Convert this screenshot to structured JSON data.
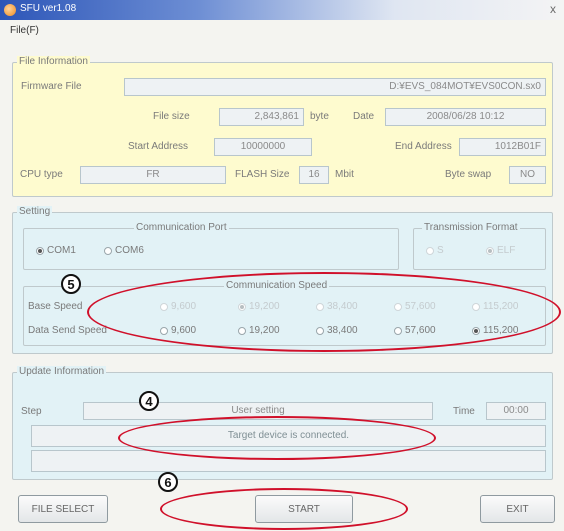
{
  "window": {
    "title": "SFU ver1.08",
    "close_glyph": "x"
  },
  "menu": {
    "items": [
      "File(F)"
    ]
  },
  "file_information": {
    "title": "File Information",
    "firmware_file_label": "Firmware File",
    "firmware_file_value": "D:¥EVS_084MOT¥EVS0CON.sx0",
    "file_size_label": "File size",
    "file_size_value": "2,843,861",
    "file_size_unit": "byte",
    "date_label": "Date",
    "date_value": "2008/06/28 10:12",
    "start_address_label": "Start Address",
    "start_address_value": "10000000",
    "end_address_label": "End Address",
    "end_address_value": "1012B01F",
    "cpu_type_label": "CPU type",
    "cpu_type_value": "FR",
    "flash_size_label": "FLASH Size",
    "flash_size_value": "16",
    "flash_size_unit": "Mbit",
    "byte_swap_label": "Byte swap",
    "byte_swap_value": "NO"
  },
  "setting": {
    "title": "Setting",
    "communication_port": {
      "title": "Communication Port",
      "options": [
        {
          "label": "COM1",
          "selected": true
        },
        {
          "label": "COM6",
          "selected": false
        }
      ]
    },
    "transmission_format": {
      "title": "Transmission Format",
      "options": [
        {
          "label": "S",
          "selected": false
        },
        {
          "label": "ELF",
          "selected": true
        }
      ]
    },
    "communication_speed": {
      "title": "Communication Speed",
      "base_speed_label": "Base Speed",
      "base_speed_options": [
        {
          "label": "9,600",
          "selected": false
        },
        {
          "label": "19,200",
          "selected": true
        },
        {
          "label": "38,400",
          "selected": false
        },
        {
          "label": "57,600",
          "selected": false
        },
        {
          "label": "115,200",
          "selected": false
        }
      ],
      "data_send_speed_label": "Data Send Speed",
      "data_send_speed_options": [
        {
          "label": "9,600",
          "selected": false
        },
        {
          "label": "19,200",
          "selected": false
        },
        {
          "label": "38,400",
          "selected": false
        },
        {
          "label": "57,600",
          "selected": false
        },
        {
          "label": "115,200",
          "selected": true
        }
      ]
    }
  },
  "update_information": {
    "title": "Update Information",
    "step_label": "Step",
    "step_value": "User setting",
    "time_label": "Time",
    "time_value": "00:00",
    "message": "Target device is connected."
  },
  "buttons": {
    "file_select": "FILE SELECT",
    "start": "START",
    "exit": "EXIT"
  },
  "callouts": {
    "speed": "5",
    "status": "4",
    "start": "6"
  },
  "colors": {
    "callout_ellipse": "#d0102a",
    "file_info_bg": "#fefbcf",
    "setting_bg": "#e2f2f6"
  }
}
